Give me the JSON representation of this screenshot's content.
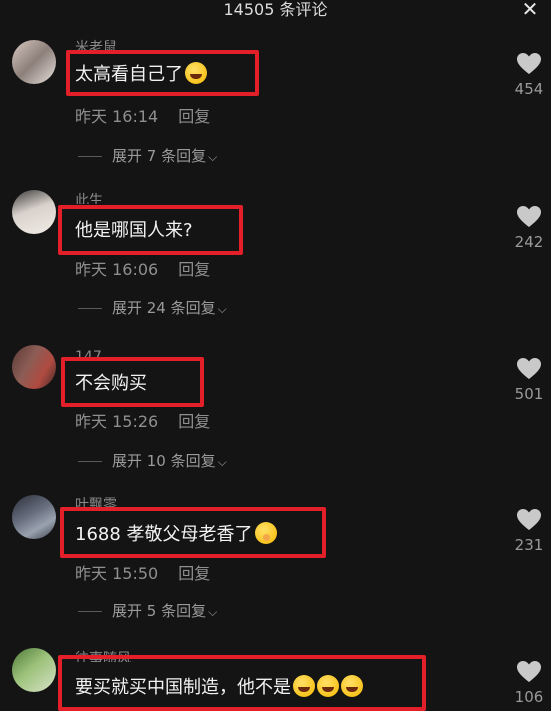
{
  "header": {
    "title": "14505 条评论",
    "close_icon": "close-icon"
  },
  "comments": [
    {
      "username": "米老鼠",
      "text": "太高看自己了",
      "emojis": [
        "laughing-tears-emoji"
      ],
      "time": "昨天 16:14",
      "reply_label": "回复",
      "expand_label": "展开 7 条回复",
      "likes": "454"
    },
    {
      "username": "此生",
      "text": "他是哪国人来?",
      "emojis": [],
      "time": "昨天 16:06",
      "reply_label": "回复",
      "expand_label": "展开 24 条回复",
      "likes": "242"
    },
    {
      "username": "147",
      "text": "不会购买",
      "emojis": [],
      "time": "昨天 15:26",
      "reply_label": "回复",
      "expand_label": "展开 10 条回复",
      "likes": "501"
    },
    {
      "username": "叶飘零",
      "text": "1688 孝敬父母老香了",
      "emojis": [
        "shushing-emoji"
      ],
      "time": "昨天 15:50",
      "reply_label": "回复",
      "expand_label": "展开 5 条回复",
      "likes": "231"
    },
    {
      "username": "往事随风",
      "text": "要买就买中国制造，他不是",
      "emojis": [
        "laughing-tears-emoji",
        "laughing-tears-emoji",
        "laughing-tears-emoji"
      ],
      "time": "",
      "reply_label": "",
      "expand_label": "",
      "likes": "106"
    }
  ],
  "colors": {
    "background": "#141414",
    "highlight_box": "#e3202a",
    "muted_text": "#8f8f8f"
  }
}
